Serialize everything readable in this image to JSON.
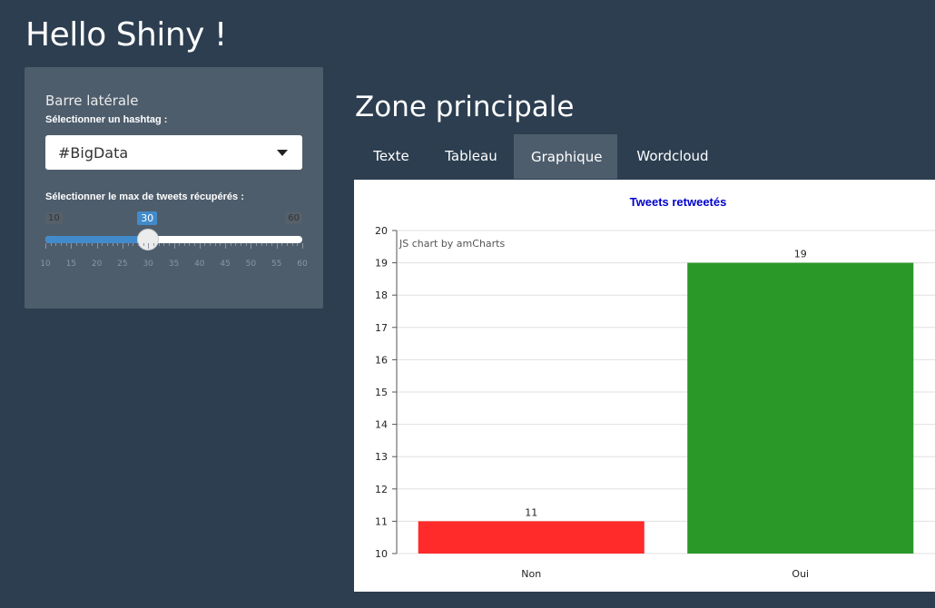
{
  "app": {
    "title": "Hello Shiny !"
  },
  "sidebar": {
    "title": "Barre latérale",
    "hashtag_label": "Sélectionner un hashtag :",
    "hashtag_value": "#BigData",
    "slider_label": "Sélectionner le max de tweets récupérés :",
    "slider": {
      "min": 10,
      "max": 60,
      "value": 30,
      "min_label": "10",
      "max_label": "60",
      "value_label": "30",
      "ticks": [
        "10",
        "15",
        "20",
        "25",
        "30",
        "35",
        "40",
        "45",
        "50",
        "55",
        "60"
      ]
    }
  },
  "main": {
    "title": "Zone principale",
    "tabs": [
      {
        "label": "Texte",
        "active": false
      },
      {
        "label": "Tableau",
        "active": false
      },
      {
        "label": "Graphique",
        "active": true
      },
      {
        "label": "Wordcloud",
        "active": false
      }
    ]
  },
  "colors": {
    "background": "#2c3e50",
    "panel": "#4e5d6c",
    "accent": "#428bca"
  },
  "chart_data": {
    "type": "bar",
    "title": "Tweets retweetés",
    "credit": "JS chart by amCharts",
    "categories": [
      "Non",
      "Oui"
    ],
    "values": [
      11,
      19
    ],
    "value_labels": [
      "11",
      "19"
    ],
    "colors": [
      "#ff2a2a",
      "#2a9828"
    ],
    "ylim": [
      10,
      20
    ],
    "yticks": [
      "10",
      "11",
      "12",
      "13",
      "14",
      "15",
      "16",
      "17",
      "18",
      "19",
      "20"
    ],
    "grid": true,
    "xlabel": "",
    "ylabel": ""
  }
}
